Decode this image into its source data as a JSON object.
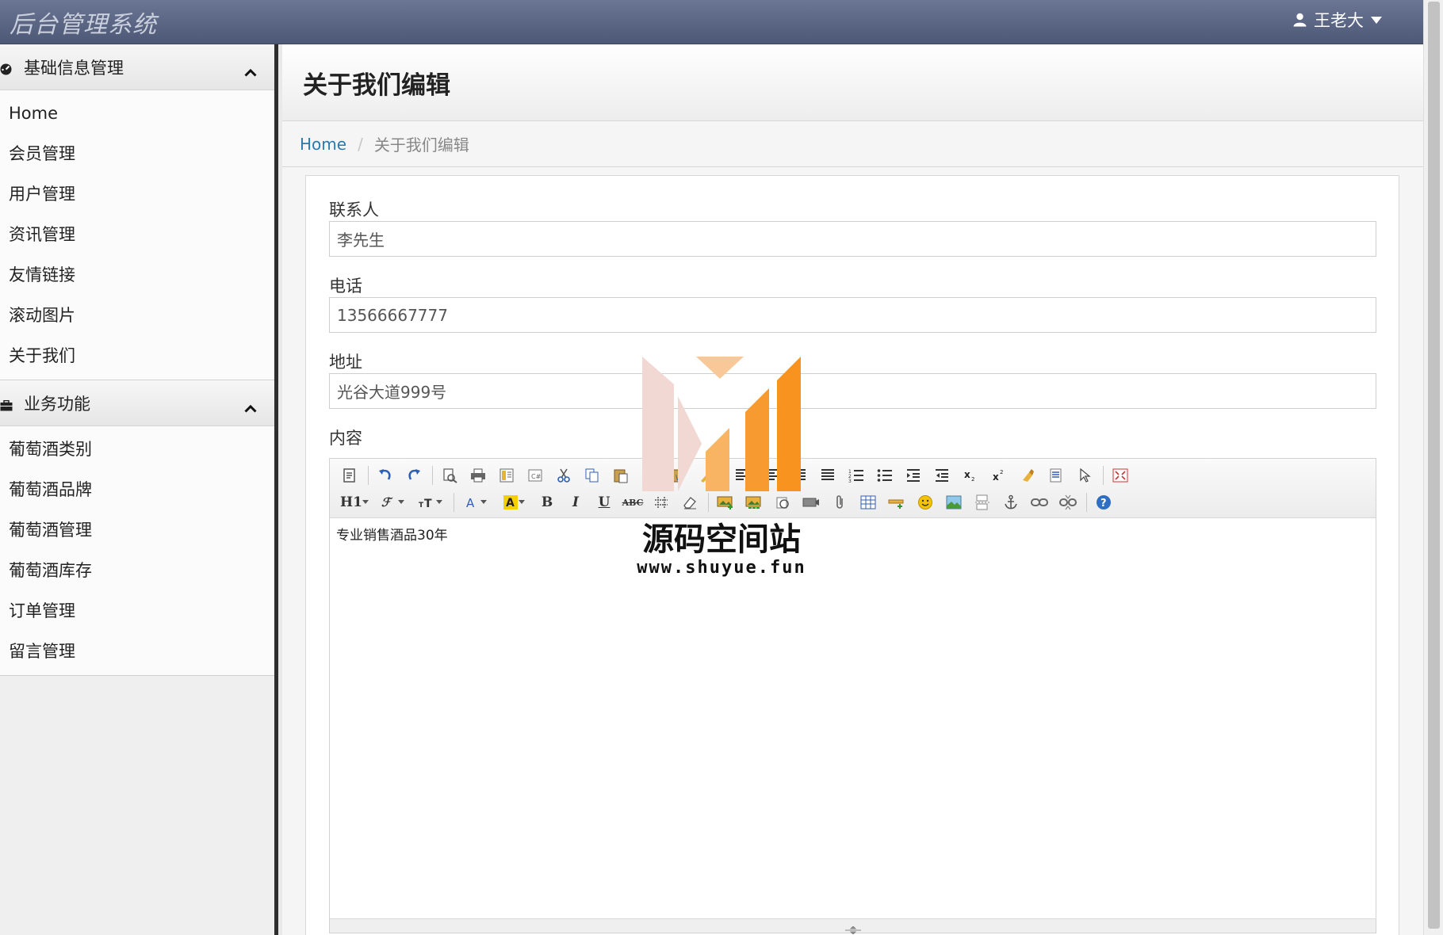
{
  "app": {
    "brand": "后台管理系统",
    "user_name": "王老大"
  },
  "sidebar": {
    "sections": [
      {
        "title": "基础信息管理",
        "items": [
          "Home",
          "会员管理",
          "用户管理",
          "资讯管理",
          "友情链接",
          "滚动图片",
          "关于我们"
        ]
      },
      {
        "title": "业务功能",
        "items": [
          "葡萄酒类别",
          "葡萄酒品牌",
          "葡萄酒管理",
          "葡萄酒库存",
          "订单管理",
          "留言管理"
        ]
      }
    ]
  },
  "page": {
    "title": "关于我们编辑",
    "breadcrumb": {
      "home": "Home",
      "separator": "/",
      "current": "关于我们编辑"
    }
  },
  "form": {
    "contact": {
      "label": "联系人",
      "value": "李先生"
    },
    "phone": {
      "label": "电话",
      "value": "13566667777"
    },
    "address": {
      "label": "地址",
      "value": "光谷大道999号"
    },
    "content": {
      "label": "内容",
      "value": "专业销售酒品30年"
    }
  },
  "editor": {
    "heading_btn": "H1",
    "bold_btn": "B",
    "italic_btn": "I",
    "underline_btn": "U",
    "strike_btn": "ABC"
  },
  "watermark": {
    "text": "源码空间站",
    "url": "www.shuyue.fun"
  },
  "colors": {
    "navbar": "#5a6584",
    "link": "#2a7ab0",
    "sidebar_border": "#2e2e2e",
    "watermark_orange": "#f7931e"
  }
}
